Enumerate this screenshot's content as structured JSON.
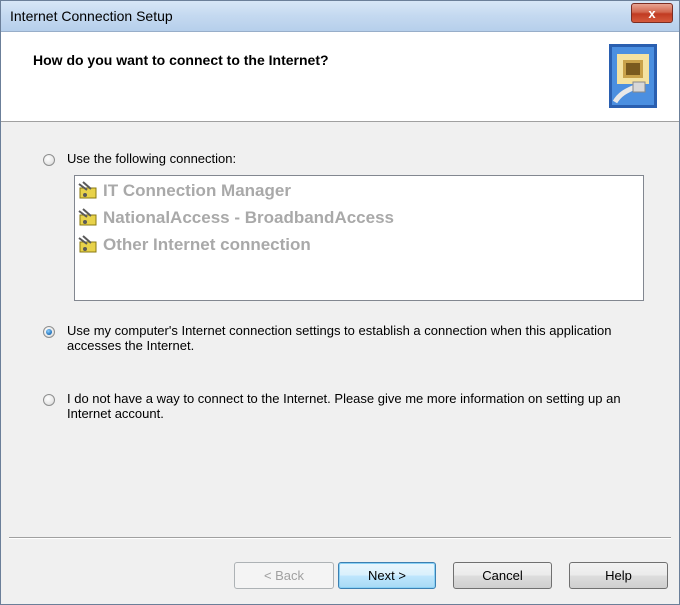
{
  "window": {
    "title": "Internet Connection Setup",
    "close_glyph": "x"
  },
  "header": {
    "question": "How do you want to connect to the Internet?",
    "icon": "connection-wizard-icon"
  },
  "options": {
    "use_following": {
      "label": "Use the following connection:",
      "checked": false
    },
    "connections": [
      {
        "label": "IT Connection Manager",
        "icon": "dialup-connection-icon"
      },
      {
        "label": "NationalAccess - BroadbandAccess",
        "icon": "dialup-connection-icon"
      },
      {
        "label": "Other Internet connection",
        "icon": "dialup-connection-icon"
      }
    ],
    "use_computer_settings": {
      "label": "Use my computer's Internet connection settings to establish a connection when this application accesses the Internet.",
      "checked": true
    },
    "no_connection": {
      "label": "I do not have a way to connect to the Internet. Please give me more information on setting up an Internet account.",
      "checked": false
    }
  },
  "buttons": {
    "back": "< Back",
    "next": "Next >",
    "cancel": "Cancel",
    "help": "Help"
  },
  "colors": {
    "accent": "#1e6fb8",
    "close": "#c13b22",
    "disabled_text": "#a9a9a9"
  }
}
